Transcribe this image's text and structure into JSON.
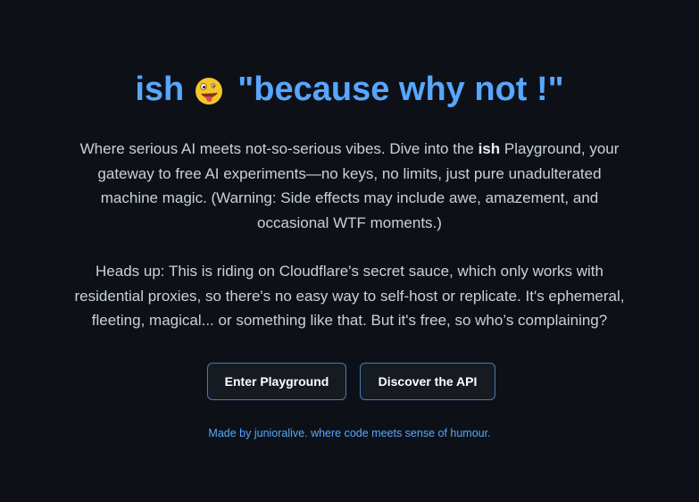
{
  "header": {
    "brand": "ish",
    "emoji_icon": "zany-face-icon",
    "tagline": "\"because why not !\""
  },
  "intro": {
    "before": "Where serious AI meets not-so-serious vibes. Dive into the ",
    "bold": "ish",
    "after": " Playground, your gateway to free AI experiments—no keys, no limits, just pure unadulterated machine magic. (Warning: Side effects may include awe, amazement, and occasional WTF moments.)"
  },
  "notice": {
    "text": "Heads up: This is riding on Cloudflare's secret sauce, which only works with residential proxies, so there's no easy way to self-host or replicate. It's ephemeral, fleeting, magical... or something like that. But it's free, so who’s complaining?"
  },
  "actions": {
    "playground_label": "Enter Playground",
    "api_label": "Discover the API"
  },
  "footer": {
    "made_by": "Made by ",
    "author": "junioralive",
    "rest": ". where code meets sense of humour."
  },
  "colors": {
    "background": "#0d1117",
    "accent": "#58a6ff",
    "text": "#c9d1d9",
    "button_border": "#4a78b5"
  }
}
